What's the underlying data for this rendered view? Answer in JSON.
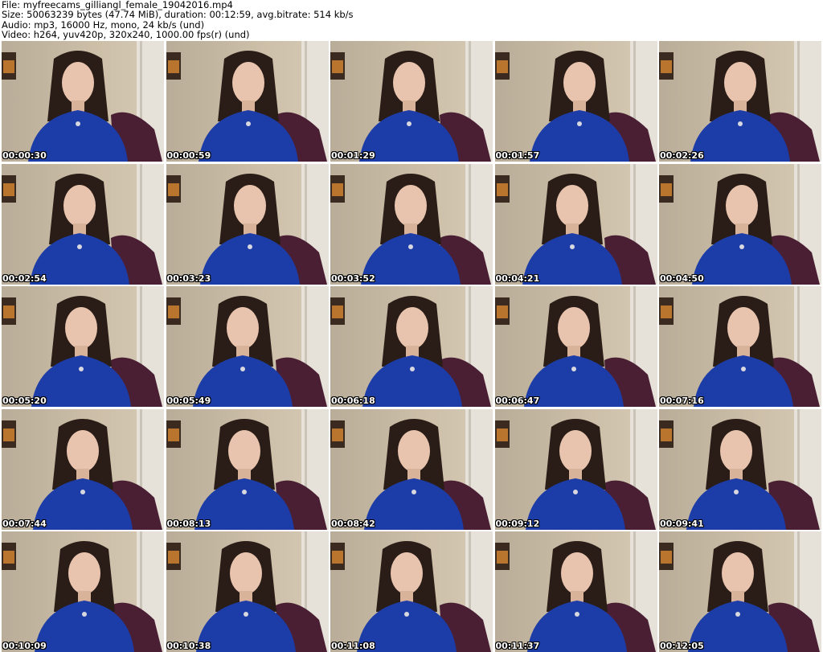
{
  "header": {
    "file_line": "File: myfreecams_gilliangl_female_19042016.mp4",
    "size_line": "Size: 50063239 bytes (47.74 MiB), duration: 00:12:59, avg.bitrate: 514 kb/s",
    "audio_line": "Audio: mp3, 16000 Hz, mono, 24 kb/s (und)",
    "video_line": "Video: h264, yuv420p, 320x240, 1000.00 fps(r) (und)"
  },
  "thumbnails": [
    {
      "timestamp": "00:00:30"
    },
    {
      "timestamp": "00:00:59"
    },
    {
      "timestamp": "00:01:29"
    },
    {
      "timestamp": "00:01:57"
    },
    {
      "timestamp": "00:02:26"
    },
    {
      "timestamp": "00:02:54"
    },
    {
      "timestamp": "00:03:23"
    },
    {
      "timestamp": "00:03:52"
    },
    {
      "timestamp": "00:04:21"
    },
    {
      "timestamp": "00:04:50"
    },
    {
      "timestamp": "00:05:20"
    },
    {
      "timestamp": "00:05:49"
    },
    {
      "timestamp": "00:06:18"
    },
    {
      "timestamp": "00:06:47"
    },
    {
      "timestamp": "00:07:16"
    },
    {
      "timestamp": "00:07:44"
    },
    {
      "timestamp": "00:08:13"
    },
    {
      "timestamp": "00:08:42"
    },
    {
      "timestamp": "00:09:12"
    },
    {
      "timestamp": "00:09:41"
    },
    {
      "timestamp": "00:10:09"
    },
    {
      "timestamp": "00:10:38"
    },
    {
      "timestamp": "00:11:08"
    },
    {
      "timestamp": "00:11:37"
    },
    {
      "timestamp": "00:12:05"
    }
  ],
  "colors": {
    "wall": "#cdbfa8",
    "door": "#e6e2da",
    "blouse": "#1c3ca8",
    "hair": "#2a1d17",
    "skin": "#e8c4ae",
    "chair": "#4a1f34",
    "frame": "#3a2a20"
  }
}
